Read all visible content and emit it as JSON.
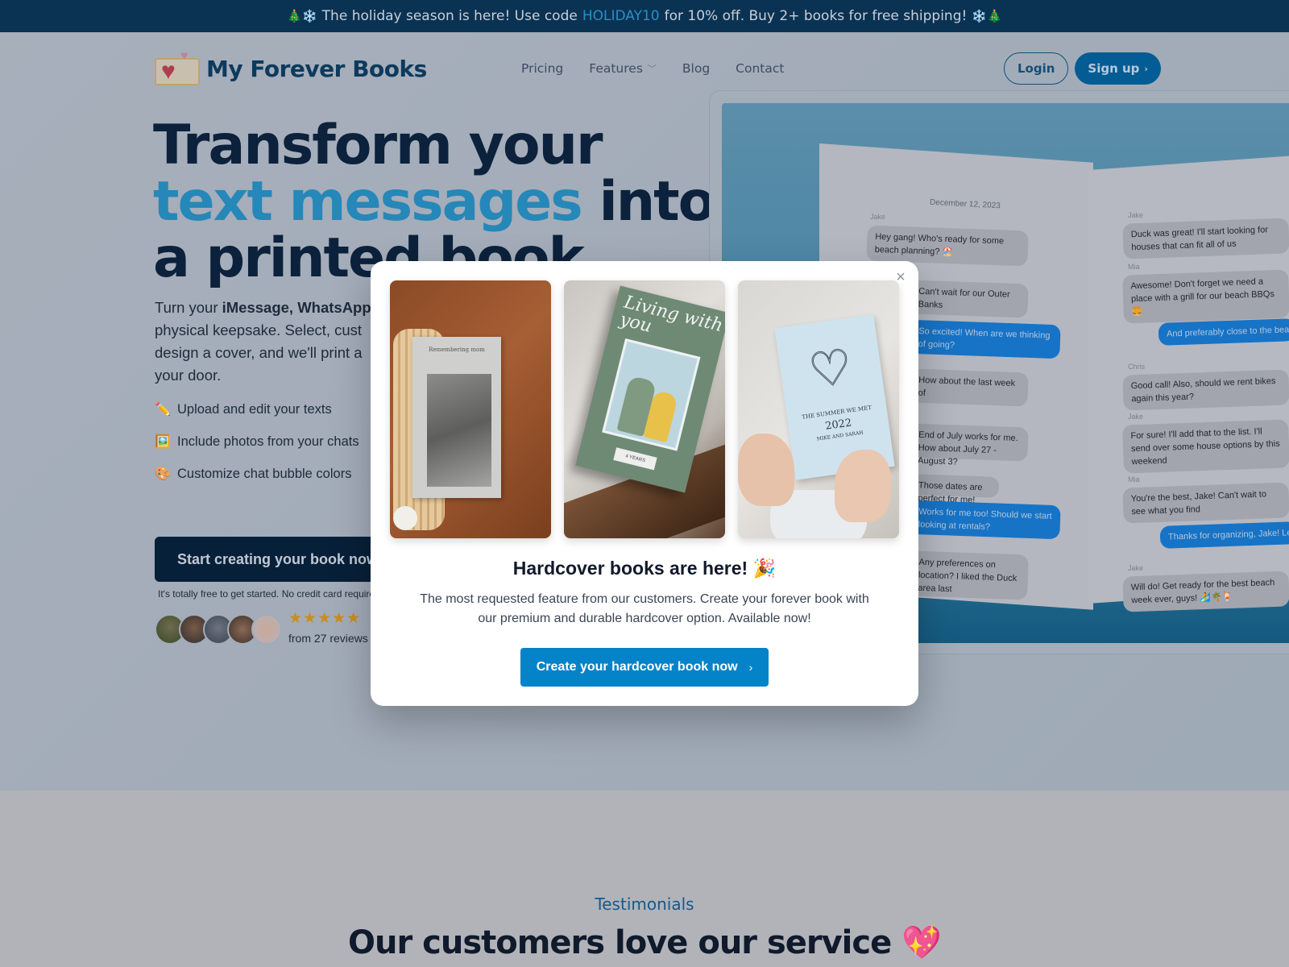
{
  "announcement": {
    "prefix_emoji": "🎄❄️",
    "text_before": "The holiday season is here! Use code",
    "code": "HOLIDAY10",
    "text_after": "for 10% off. Buy 2+ books for free shipping!",
    "suffix_emoji": "❄️🎄"
  },
  "brand": {
    "name": "My Forever Books",
    "logo_icon": "book-heart-icon"
  },
  "nav": {
    "items": [
      {
        "label": "Pricing"
      },
      {
        "label": "Features",
        "has_dropdown": true
      },
      {
        "label": "Blog"
      },
      {
        "label": "Contact"
      }
    ],
    "login_label": "Login",
    "signup_label": "Sign up"
  },
  "hero": {
    "headline_line1": "Transform your",
    "headline_accent": "text messages",
    "headline_after_accent": "into",
    "headline_line3": "a printed book",
    "subtitle_start": "Turn your ",
    "subtitle_bold": "iMessage, WhatsApp",
    "subtitle_line2": "physical keepsake. Select, cust",
    "subtitle_line3": "design a cover, and we'll print a",
    "subtitle_line4": "your door.",
    "features": [
      {
        "icon": "✏️",
        "icon_name": "pencil-icon",
        "label": "Upload and edit your texts"
      },
      {
        "icon": "🖼️",
        "icon_name": "picture-icon",
        "label": "Include photos from your chats"
      },
      {
        "icon": "🎨",
        "icon_name": "palette-icon",
        "label": "Customize chat bubble colors"
      }
    ],
    "cta_label": "Start creating your book now",
    "cta_note": "It's totally free to get started. No credit card required.",
    "rating_stars": 5,
    "stars_text": "★★★★★",
    "reviews_text": "from 27 reviews"
  },
  "mockup": {
    "date": "December 12, 2023",
    "left_messages": [
      {
        "sender": "Jake",
        "text": "Hey gang! Who's ready for some beach planning? 🏖️",
        "outgoing": false
      },
      {
        "sender": "",
        "text": "Can't wait for our Outer Banks",
        "outgoing": false
      },
      {
        "sender": "",
        "text": "So excited! When are we thinking of going?",
        "outgoing": true
      },
      {
        "sender": "",
        "text": "How about the last week of",
        "outgoing": false
      },
      {
        "sender": "",
        "text": "End of July works for me. How about July 27 - August 3?",
        "outgoing": false
      },
      {
        "sender": "",
        "text": "Those dates are perfect for me!",
        "outgoing": false
      },
      {
        "sender": "",
        "text": "Works for me too! Should we start looking at rentals?",
        "outgoing": true
      },
      {
        "sender": "",
        "text": "Any preferences on location? I liked the Duck area last",
        "outgoing": false
      }
    ],
    "right_messages": [
      {
        "sender": "Jake",
        "text": "Duck was great! I'll start looking for houses that can fit all of us",
        "outgoing": false
      },
      {
        "sender": "Mia",
        "text": "Awesome! Don't forget we need a place with a grill for our beach BBQs 🍔",
        "outgoing": false
      },
      {
        "sender": "",
        "text": "And preferably close to the beach, I want to maximize my sun time",
        "outgoing": true
      },
      {
        "sender": "Chris",
        "text": "Good call! Also, should we rent bikes again this year?",
        "outgoing": false
      },
      {
        "sender": "Jake",
        "text": "For sure! I'll add that to the list. I'll send over some house options by this weekend",
        "outgoing": false
      },
      {
        "sender": "Mia",
        "text": "You're the best, Jake! Can't wait to see what you find",
        "outgoing": false
      },
      {
        "sender": "",
        "text": "Thanks for organizing, Jake! Let me know if you need help with anything",
        "outgoing": true
      },
      {
        "sender": "Jake",
        "text": "Will do! Get ready for the best beach week ever, guys! 🏄🌴🍹",
        "outgoing": false
      }
    ]
  },
  "modal": {
    "images": [
      {
        "alt": "Remembering mom book",
        "cover_text": "Remembering mom"
      },
      {
        "alt": "Living with you hardcover book",
        "cover_text": "Living with you",
        "badge": "4 YEARS"
      },
      {
        "alt": "The summer we met book",
        "line1": "THE SUMMER WE MET",
        "line2": "2022",
        "line3": "MIKE AND SARAH"
      }
    ],
    "title": "Hardcover books are here! 🎉",
    "description": "The most requested feature from our customers. Create your forever book with our premium and durable hardcover option. Available now!",
    "cta_label": "Create your hardcover book now",
    "close_label": "×"
  },
  "testimonials": {
    "label": "Testimonials",
    "title": "Our customers love our service 💖"
  },
  "colors": {
    "accent": "#2687b9",
    "navy": "#0c213b",
    "cta_blue": "#0583c8",
    "announce_bg": "#0a3253",
    "star": "#c88d22"
  }
}
